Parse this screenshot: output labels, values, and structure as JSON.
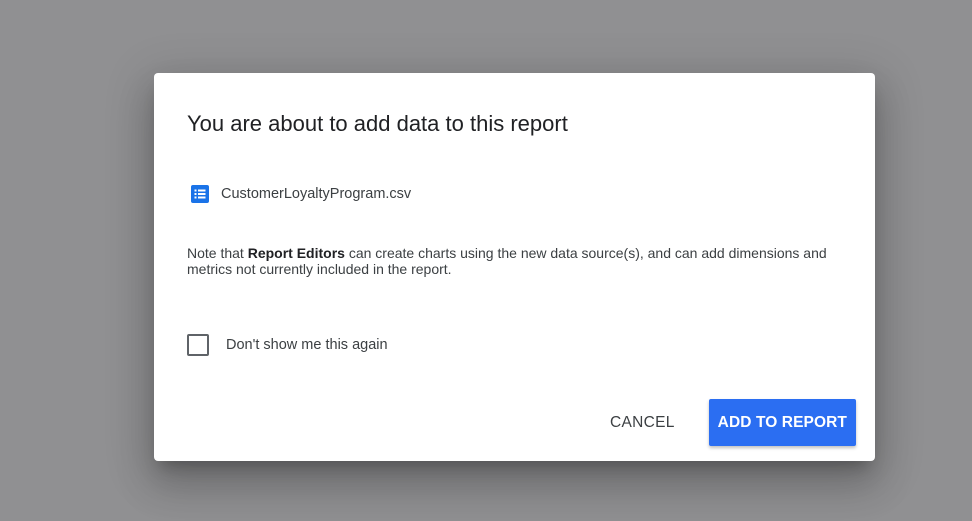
{
  "dialog": {
    "title": "You are about to add data to this report",
    "source": {
      "icon": "data-source-list-icon",
      "name": "CustomerLoyaltyProgram.csv",
      "icon_color": "#1a73e8"
    },
    "note": {
      "prefix": "Note that ",
      "bold": "Report Editors",
      "suffix": " can create charts using the new data source(s), and can add dimensions and metrics not currently included in the report."
    },
    "checkbox": {
      "label": "Don't show me this again",
      "checked": false
    },
    "actions": {
      "cancel_label": "CANCEL",
      "add_label": "ADD TO REPORT",
      "primary_color": "#2b6ef2"
    }
  },
  "backdrop_color": "#909092"
}
